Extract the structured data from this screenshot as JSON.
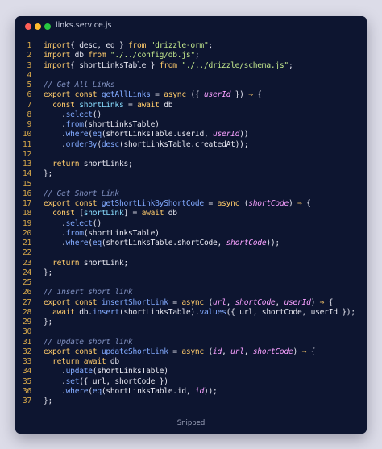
{
  "window": {
    "title": "links.service.js",
    "footer": "Snipped"
  },
  "code_lines": [
    {
      "n": "1",
      "t": [
        [
          "kw",
          "import"
        ],
        [
          "",
          "{ desc, eq } "
        ],
        [
          "kw",
          "from"
        ],
        [
          "str",
          " \"drizzle-orm\""
        ],
        [
          "",
          ";"
        ]
      ]
    },
    {
      "n": "2",
      "t": [
        [
          "kw",
          "import"
        ],
        [
          "",
          " db "
        ],
        [
          "kw",
          "from"
        ],
        [
          "str",
          " \"./../config/db.js\""
        ],
        [
          "",
          ";"
        ]
      ]
    },
    {
      "n": "3",
      "t": [
        [
          "kw",
          "import"
        ],
        [
          "",
          "{ shortLinksTable } "
        ],
        [
          "kw",
          "from"
        ],
        [
          "str",
          " \"./../drizzle/schema.js\""
        ],
        [
          "",
          ";"
        ]
      ]
    },
    {
      "n": "4",
      "t": []
    },
    {
      "n": "5",
      "t": [
        [
          "cm",
          "// Get All Links"
        ]
      ]
    },
    {
      "n": "6",
      "t": [
        [
          "kw",
          "export const "
        ],
        [
          "fn",
          "getAllLinks"
        ],
        [
          "",
          " = "
        ],
        [
          "kw",
          "async"
        ],
        [
          "",
          " ({ "
        ],
        [
          "par",
          "userId"
        ],
        [
          "",
          " }) "
        ],
        [
          "op",
          "⇒"
        ],
        [
          "",
          " {"
        ]
      ]
    },
    {
      "n": "7",
      "t": [
        [
          "",
          "  "
        ],
        [
          "kw",
          "const "
        ],
        [
          "pr",
          "shortLinks"
        ],
        [
          "",
          " = "
        ],
        [
          "kw",
          "await"
        ],
        [
          "",
          " db"
        ]
      ]
    },
    {
      "n": "8",
      "t": [
        [
          "",
          "    ."
        ],
        [
          "fn",
          "select"
        ],
        [
          "",
          "()"
        ]
      ]
    },
    {
      "n": "9",
      "t": [
        [
          "",
          "    ."
        ],
        [
          "fn",
          "from"
        ],
        [
          "",
          "(shortLinksTable)"
        ]
      ]
    },
    {
      "n": "10",
      "t": [
        [
          "",
          "    ."
        ],
        [
          "fn",
          "where"
        ],
        [
          "",
          "("
        ],
        [
          "fn",
          "eq"
        ],
        [
          "",
          "(shortLinksTable.userId, "
        ],
        [
          "par",
          "userId"
        ],
        [
          "",
          "))"
        ]
      ]
    },
    {
      "n": "11",
      "t": [
        [
          "",
          "    ."
        ],
        [
          "fn",
          "orderBy"
        ],
        [
          "",
          "("
        ],
        [
          "fn",
          "desc"
        ],
        [
          "",
          "(shortLinksTable.createdAt));"
        ]
      ]
    },
    {
      "n": "12",
      "t": []
    },
    {
      "n": "13",
      "t": [
        [
          "",
          "  "
        ],
        [
          "kw",
          "return"
        ],
        [
          "",
          " shortLinks;"
        ]
      ]
    },
    {
      "n": "14",
      "t": [
        [
          "",
          "};"
        ]
      ]
    },
    {
      "n": "15",
      "t": []
    },
    {
      "n": "16",
      "t": [
        [
          "cm",
          "// Get Short Link"
        ]
      ]
    },
    {
      "n": "17",
      "t": [
        [
          "kw",
          "export const "
        ],
        [
          "fn",
          "getShortLinkByShortCode"
        ],
        [
          "",
          " = "
        ],
        [
          "kw",
          "async"
        ],
        [
          "",
          " ("
        ],
        [
          "par",
          "shortCode"
        ],
        [
          "",
          ") "
        ],
        [
          "op",
          "⇒"
        ],
        [
          "",
          " {"
        ]
      ]
    },
    {
      "n": "18",
      "t": [
        [
          "",
          "  "
        ],
        [
          "kw",
          "const "
        ],
        [
          "",
          "["
        ],
        [
          "pr",
          "shortLink"
        ],
        [
          "",
          "] = "
        ],
        [
          "kw",
          "await"
        ],
        [
          "",
          " db"
        ]
      ]
    },
    {
      "n": "19",
      "t": [
        [
          "",
          "    ."
        ],
        [
          "fn",
          "select"
        ],
        [
          "",
          "()"
        ]
      ]
    },
    {
      "n": "20",
      "t": [
        [
          "",
          "    ."
        ],
        [
          "fn",
          "from"
        ],
        [
          "",
          "(shortLinksTable)"
        ]
      ]
    },
    {
      "n": "21",
      "t": [
        [
          "",
          "    ."
        ],
        [
          "fn",
          "where"
        ],
        [
          "",
          "("
        ],
        [
          "fn",
          "eq"
        ],
        [
          "",
          "(shortLinksTable.shortCode, "
        ],
        [
          "par",
          "shortCode"
        ],
        [
          "",
          "));"
        ]
      ]
    },
    {
      "n": "22",
      "t": []
    },
    {
      "n": "23",
      "t": [
        [
          "",
          "  "
        ],
        [
          "kw",
          "return"
        ],
        [
          "",
          " shortLink;"
        ]
      ]
    },
    {
      "n": "24",
      "t": [
        [
          "",
          "};"
        ]
      ]
    },
    {
      "n": "25",
      "t": []
    },
    {
      "n": "26",
      "t": [
        [
          "cm",
          "// insert short link"
        ]
      ]
    },
    {
      "n": "27",
      "t": [
        [
          "kw",
          "export const "
        ],
        [
          "fn",
          "insertShortLink"
        ],
        [
          "",
          " = "
        ],
        [
          "kw",
          "async"
        ],
        [
          "",
          " ("
        ],
        [
          "par",
          "url"
        ],
        [
          "",
          ", "
        ],
        [
          "par",
          "shortCode"
        ],
        [
          "",
          ", "
        ],
        [
          "par",
          "userId"
        ],
        [
          "",
          ") "
        ],
        [
          "op",
          "⇒"
        ],
        [
          "",
          " {"
        ]
      ]
    },
    {
      "n": "28",
      "t": [
        [
          "",
          "  "
        ],
        [
          "kw",
          "await"
        ],
        [
          "",
          " db."
        ],
        [
          "fn",
          "insert"
        ],
        [
          "",
          "(shortLinksTable)."
        ],
        [
          "fn",
          "values"
        ],
        [
          "",
          "({ url, shortCode, userId });"
        ]
      ]
    },
    {
      "n": "29",
      "t": [
        [
          "",
          "};"
        ]
      ]
    },
    {
      "n": "30",
      "t": []
    },
    {
      "n": "31",
      "t": [
        [
          "cm",
          "// update short link"
        ]
      ]
    },
    {
      "n": "32",
      "t": [
        [
          "kw",
          "export const "
        ],
        [
          "fn",
          "updateShortLink"
        ],
        [
          "",
          " = "
        ],
        [
          "kw",
          "async"
        ],
        [
          "",
          " ("
        ],
        [
          "par",
          "id"
        ],
        [
          "",
          ", "
        ],
        [
          "par",
          "url"
        ],
        [
          "",
          ", "
        ],
        [
          "par",
          "shortCode"
        ],
        [
          "",
          ") "
        ],
        [
          "op",
          "⇒"
        ],
        [
          "",
          " {"
        ]
      ]
    },
    {
      "n": "33",
      "t": [
        [
          "",
          "  "
        ],
        [
          "kw",
          "return await"
        ],
        [
          "",
          " db"
        ]
      ]
    },
    {
      "n": "34",
      "t": [
        [
          "",
          "    ."
        ],
        [
          "fn",
          "update"
        ],
        [
          "",
          "(shortLinksTable)"
        ]
      ]
    },
    {
      "n": "35",
      "t": [
        [
          "",
          "    ."
        ],
        [
          "fn",
          "set"
        ],
        [
          "",
          "({ url, shortCode })"
        ]
      ]
    },
    {
      "n": "36",
      "t": [
        [
          "",
          "    ."
        ],
        [
          "fn",
          "where"
        ],
        [
          "",
          "("
        ],
        [
          "fn",
          "eq"
        ],
        [
          "",
          "(shortLinksTable.id, "
        ],
        [
          "par",
          "id"
        ],
        [
          "",
          "));"
        ]
      ]
    },
    {
      "n": "37",
      "t": [
        [
          "",
          "};"
        ]
      ]
    }
  ]
}
